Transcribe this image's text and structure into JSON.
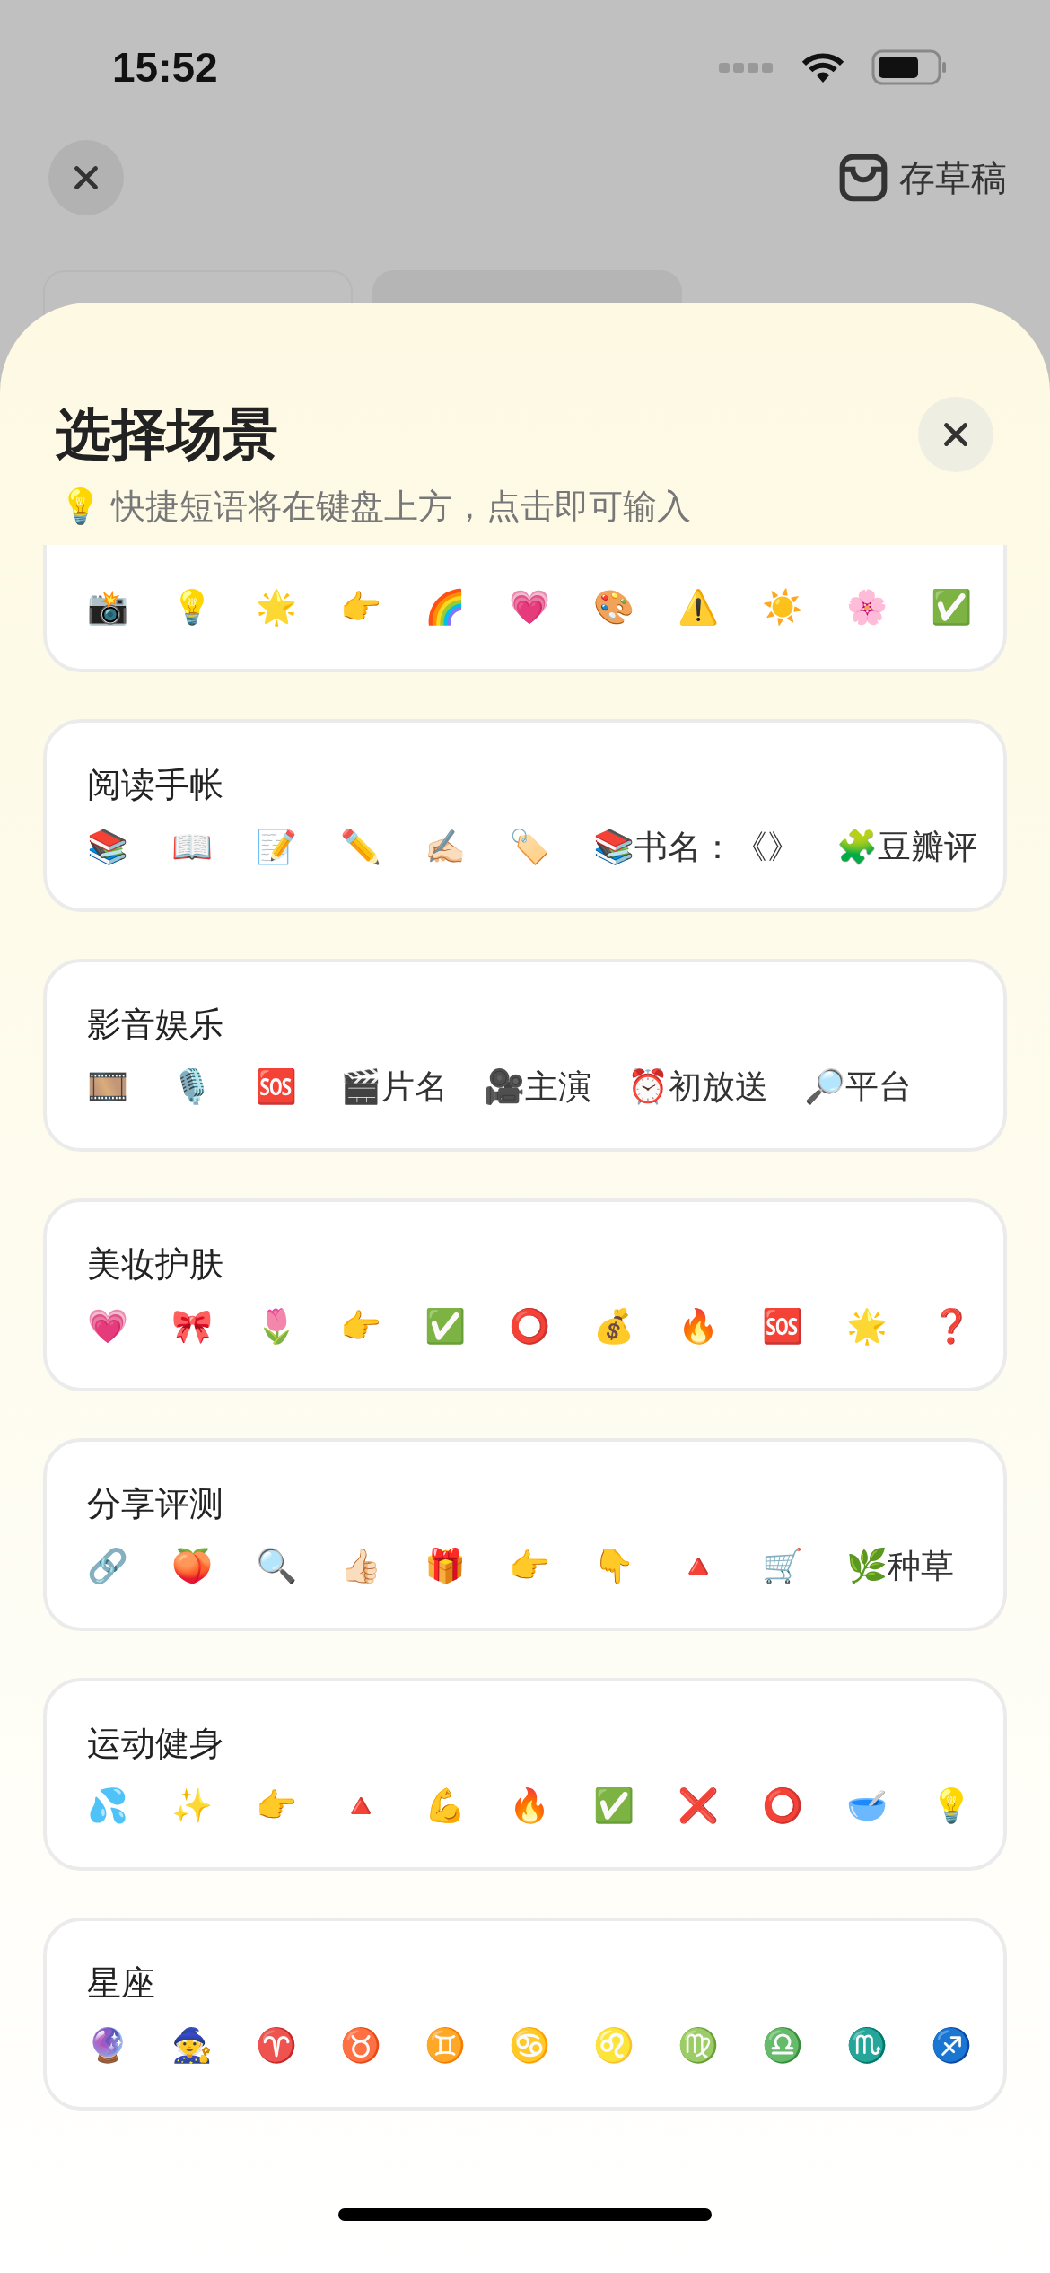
{
  "status_bar": {
    "time": "15:52"
  },
  "nav": {
    "save_draft": "存草稿"
  },
  "sheet": {
    "title": "选择场景",
    "hint": "💡 快捷短语将在键盘上方，点击即可输入"
  },
  "scenes": [
    {
      "chips": [
        "📸",
        "💡",
        "🌟",
        "👉",
        "🌈",
        "💗",
        "🎨",
        "⚠️",
        "☀️",
        "🌸",
        "✅"
      ]
    },
    {
      "title": "阅读手帐",
      "chips": [
        "📚",
        "📖",
        "📝",
        "✏️",
        "✍🏻",
        "🏷️",
        "📚书名：《》",
        "🧩豆瓣评"
      ]
    },
    {
      "title": "影音娱乐",
      "chips": [
        "🎞️",
        "🎙️",
        "🆘",
        "🎬片名",
        "🎥主演",
        "⏰初放送",
        "🔎平台"
      ]
    },
    {
      "title": "美妆护肤",
      "chips": [
        "💗",
        "🎀",
        "🌷",
        "👉",
        "✅",
        "⭕",
        "💰",
        "🔥",
        "🆘",
        "🌟",
        "❓"
      ]
    },
    {
      "title": "分享评测",
      "chips": [
        "🔗",
        "🍑",
        "🔍",
        "👍🏻",
        "🎁",
        "👉",
        "👇",
        "🔺",
        "🛒",
        "🌿种草"
      ]
    },
    {
      "title": "运动健身",
      "chips": [
        "💦",
        "✨",
        "👉",
        "🔺",
        "💪",
        "🔥",
        "✅",
        "❌",
        "⭕",
        "🥣",
        "💡"
      ]
    },
    {
      "title": "星座",
      "chips": [
        "🔮",
        "🧙",
        "♈",
        "♉",
        "♊",
        "♋",
        "♌",
        "♍",
        "♎",
        "♏",
        "♐"
      ]
    }
  ]
}
